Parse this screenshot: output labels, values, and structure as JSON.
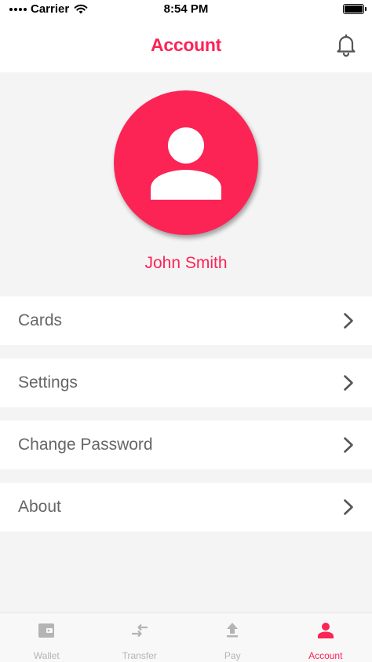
{
  "status_bar": {
    "carrier": "Carrier",
    "time": "8:54 PM"
  },
  "header": {
    "title": "Account",
    "bell_icon": "bell-icon"
  },
  "profile": {
    "name": "John Smith",
    "avatar_icon": "user-icon"
  },
  "menu": [
    {
      "label": "Cards"
    },
    {
      "label": "Settings"
    },
    {
      "label": "Change Password"
    },
    {
      "label": "About"
    }
  ],
  "tabs": [
    {
      "label": "Wallet",
      "icon": "wallet-icon",
      "active": false
    },
    {
      "label": "Transfer",
      "icon": "transfer-icon",
      "active": false
    },
    {
      "label": "Pay",
      "icon": "upload-icon",
      "active": false
    },
    {
      "label": "Account",
      "icon": "user-icon",
      "active": true
    }
  ],
  "colors": {
    "accent": "#fb2455",
    "inactive_tab": "#b4b4b4",
    "menu_text": "#666666",
    "background": "#f4f4f4"
  }
}
